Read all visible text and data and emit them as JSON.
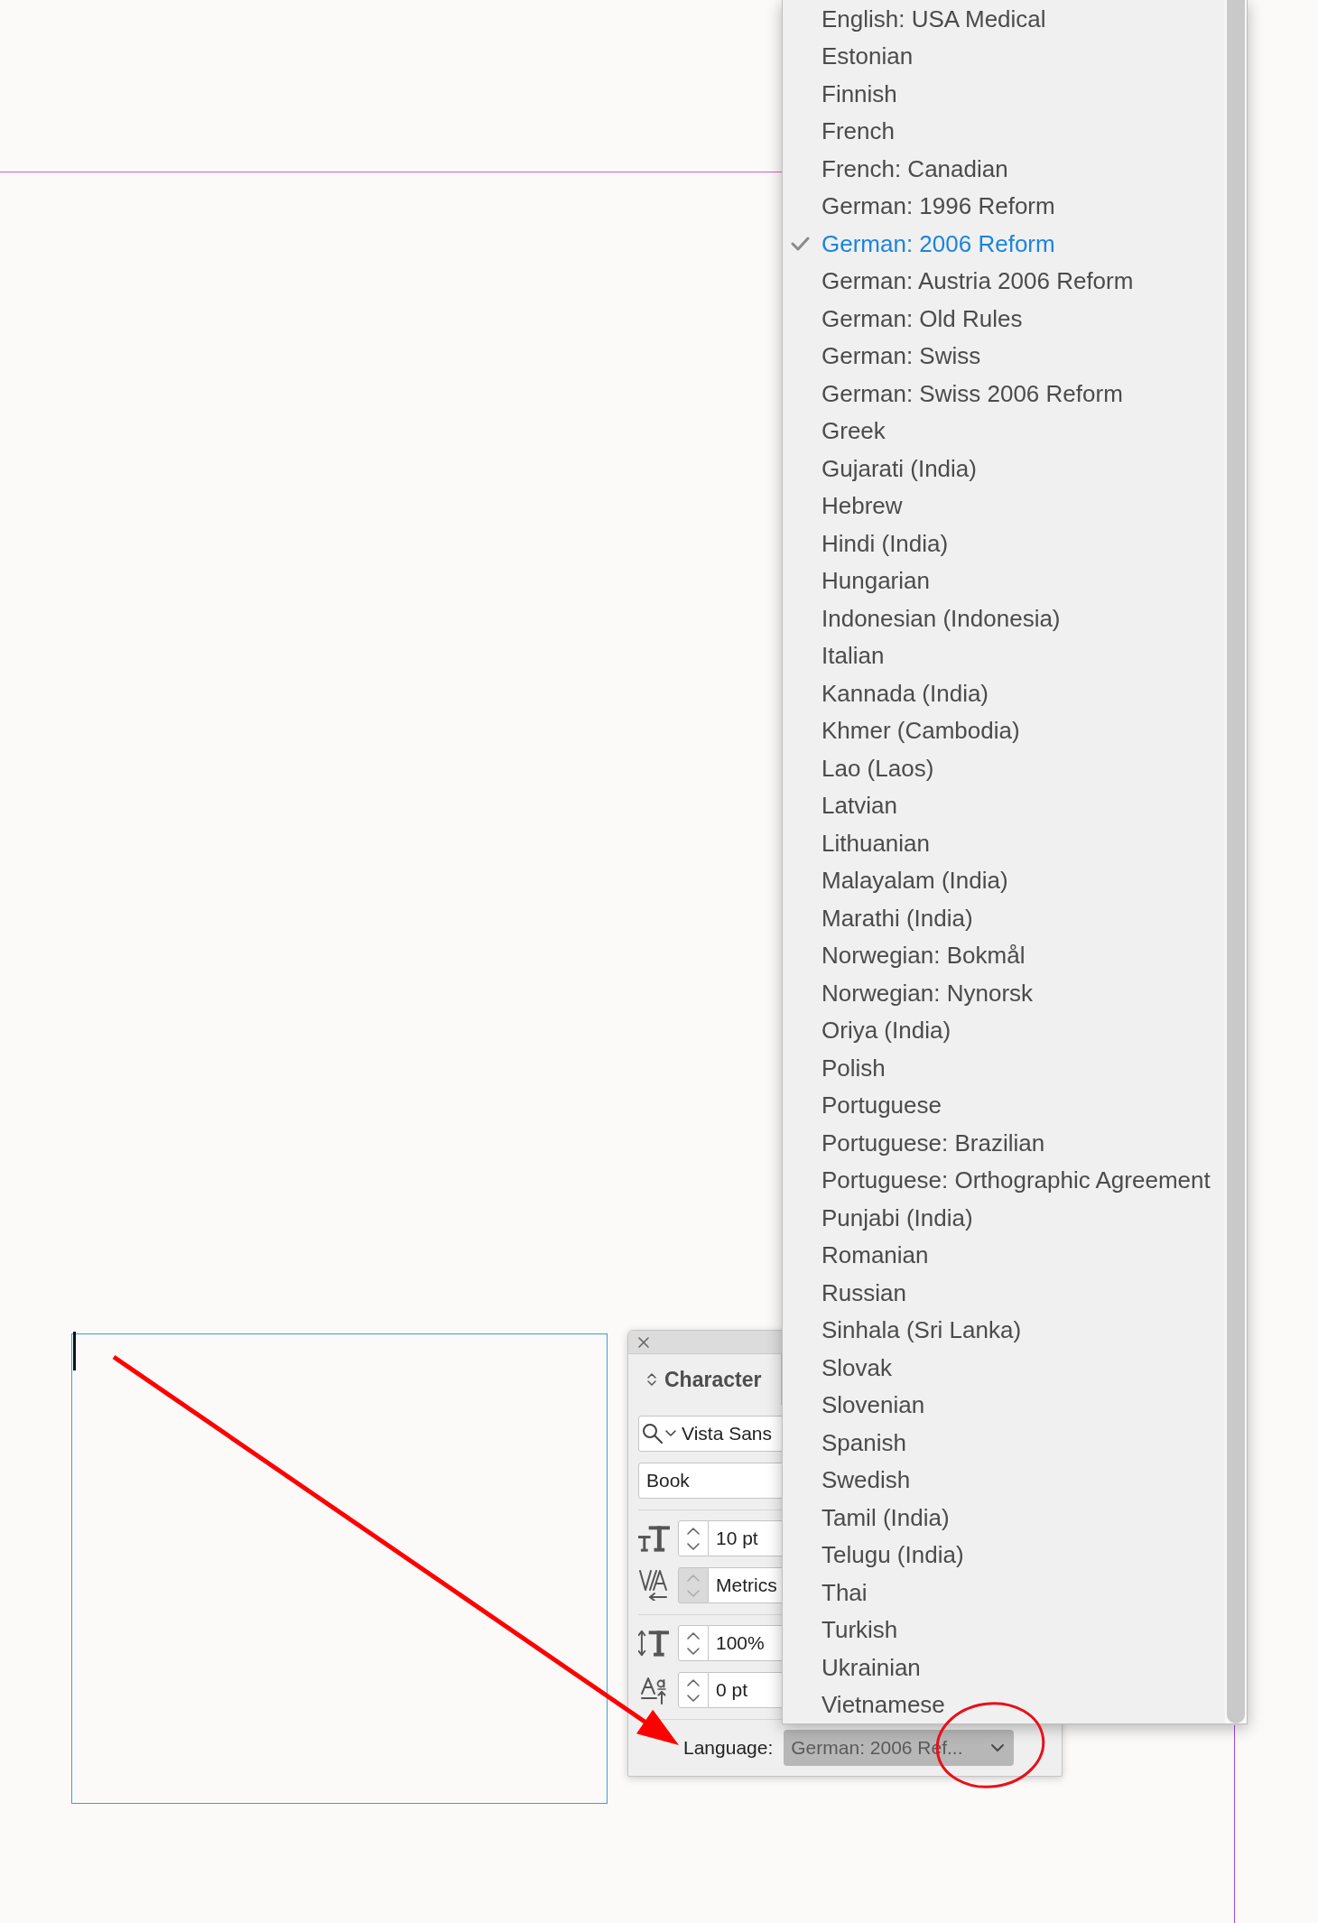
{
  "character_panel": {
    "title": "Character",
    "font_family": {
      "value": "Vista Sans"
    },
    "font_style": {
      "value": "Book"
    },
    "control_groups": [
      {
        "controls": [
          {
            "kind": "font_size",
            "value": "10 pt",
            "disabled": false
          },
          {
            "kind": "kerning",
            "value": "Metrics",
            "disabled": true
          }
        ]
      },
      {
        "controls": [
          {
            "kind": "vertical_scale",
            "value": "100%",
            "disabled": false
          },
          {
            "kind": "baseline_shift",
            "value": "0 pt",
            "disabled": false
          }
        ]
      }
    ],
    "language": {
      "label": "Language:",
      "value": "German: 2006 Ref...",
      "expanded": true
    }
  },
  "language_menu": {
    "items": [
      {
        "label": "English: USA Medical",
        "selected": false
      },
      {
        "label": "Estonian",
        "selected": false
      },
      {
        "label": "Finnish",
        "selected": false
      },
      {
        "label": "French",
        "selected": false
      },
      {
        "label": "French: Canadian",
        "selected": false
      },
      {
        "label": "German: 1996 Reform",
        "selected": false
      },
      {
        "label": "German: 2006 Reform",
        "selected": true
      },
      {
        "label": "German: Austria 2006 Reform",
        "selected": false
      },
      {
        "label": "German: Old Rules",
        "selected": false
      },
      {
        "label": "German: Swiss",
        "selected": false
      },
      {
        "label": "German: Swiss 2006 Reform",
        "selected": false
      },
      {
        "label": "Greek",
        "selected": false
      },
      {
        "label": "Gujarati (India)",
        "selected": false
      },
      {
        "label": "Hebrew",
        "selected": false
      },
      {
        "label": "Hindi (India)",
        "selected": false
      },
      {
        "label": "Hungarian",
        "selected": false
      },
      {
        "label": "Indonesian (Indonesia)",
        "selected": false
      },
      {
        "label": "Italian",
        "selected": false
      },
      {
        "label": "Kannada (India)",
        "selected": false
      },
      {
        "label": "Khmer (Cambodia)",
        "selected": false
      },
      {
        "label": "Lao (Laos)",
        "selected": false
      },
      {
        "label": "Latvian",
        "selected": false
      },
      {
        "label": "Lithuanian",
        "selected": false
      },
      {
        "label": "Malayalam (India)",
        "selected": false
      },
      {
        "label": "Marathi (India)",
        "selected": false
      },
      {
        "label": "Norwegian: Bokmål",
        "selected": false
      },
      {
        "label": "Norwegian: Nynorsk",
        "selected": false
      },
      {
        "label": "Oriya (India)",
        "selected": false
      },
      {
        "label": "Polish",
        "selected": false
      },
      {
        "label": "Portuguese",
        "selected": false
      },
      {
        "label": "Portuguese: Brazilian",
        "selected": false
      },
      {
        "label": "Portuguese: Orthographic Agreement",
        "selected": false
      },
      {
        "label": "Punjabi (India)",
        "selected": false
      },
      {
        "label": "Romanian",
        "selected": false
      },
      {
        "label": "Russian",
        "selected": false
      },
      {
        "label": "Sinhala (Sri Lanka)",
        "selected": false
      },
      {
        "label": "Slovak",
        "selected": false
      },
      {
        "label": "Slovenian",
        "selected": false
      },
      {
        "label": "Spanish",
        "selected": false
      },
      {
        "label": "Swedish",
        "selected": false
      },
      {
        "label": "Tamil (India)",
        "selected": false
      },
      {
        "label": "Telugu (India)",
        "selected": false
      },
      {
        "label": "Thai",
        "selected": false
      },
      {
        "label": "Turkish",
        "selected": false
      },
      {
        "label": "Ukrainian",
        "selected": false
      },
      {
        "label": "Vietnamese",
        "selected": false
      }
    ]
  }
}
